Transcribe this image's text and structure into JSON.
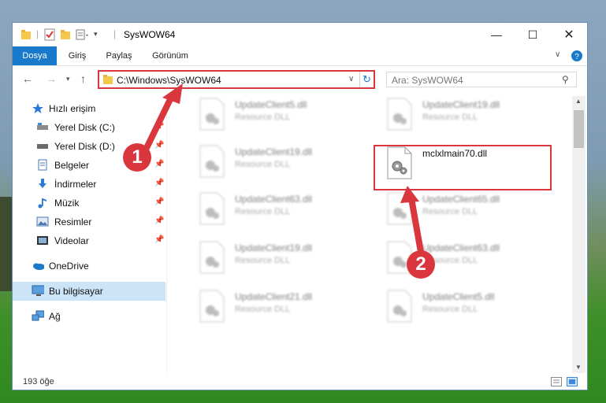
{
  "window": {
    "title": "SysWOW64"
  },
  "ribbon": {
    "tabs": [
      "Dosya",
      "Giriş",
      "Paylaş",
      "Görünüm"
    ]
  },
  "address": {
    "path": "C:\\Windows\\SysWOW64"
  },
  "search": {
    "placeholder": "Ara: SysWOW64"
  },
  "sidebar": {
    "quick_access": "Hızlı erişim",
    "items": [
      {
        "label": "Yerel Disk (C:)",
        "icon": "drive-icon"
      },
      {
        "label": "Yerel Disk (D:)",
        "icon": "drive-icon"
      },
      {
        "label": "Belgeler",
        "icon": "documents-icon"
      },
      {
        "label": "İndirmeler",
        "icon": "download-icon"
      },
      {
        "label": "Müzik",
        "icon": "music-icon"
      },
      {
        "label": "Resimler",
        "icon": "pictures-icon"
      },
      {
        "label": "Videolar",
        "icon": "videos-icon"
      }
    ],
    "onedrive": "OneDrive",
    "this_pc": "Bu bilgisayar",
    "network": "Ağ"
  },
  "files": [
    {
      "name": "UpdateClient5.dll",
      "type": "Resource DLL"
    },
    {
      "name": "UpdateClient19.dll",
      "type": "Resource DLL"
    },
    {
      "name": "UpdateClient19.dll",
      "type": "Resource DLL"
    },
    {
      "name": "mclxlmain70.dll",
      "type": ""
    },
    {
      "name": "UpdateClient63.dll",
      "type": "Resource DLL"
    },
    {
      "name": "UpdateClient65.dll",
      "type": "Resource DLL"
    },
    {
      "name": "UpdateClient19.dll",
      "type": "Resource DLL"
    },
    {
      "name": "UpdateClient63.dll",
      "type": "Resource DLL"
    },
    {
      "name": "UpdateClient21.dll",
      "type": "Resource DLL"
    },
    {
      "name": "UpdateClient5.dll",
      "type": "Resource DLL"
    }
  ],
  "status": {
    "count": "193 öğe"
  },
  "callouts": [
    "1",
    "2"
  ],
  "colors": {
    "accent": "#1979ca",
    "annotation": "#d9363e",
    "selected": "#cce4f7"
  }
}
